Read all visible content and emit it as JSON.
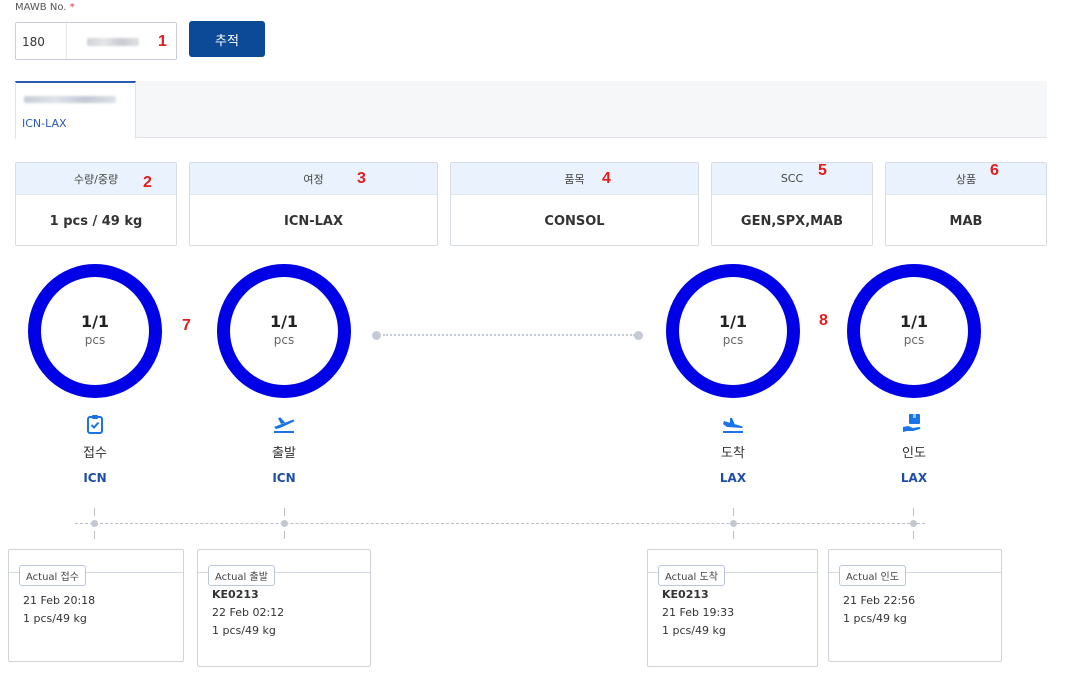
{
  "search": {
    "label": "MAWB No.",
    "required_mark": "*",
    "prefix_value": "180",
    "button_label": "추적"
  },
  "tab": {
    "route": "ICN-LAX"
  },
  "markers": [
    "1",
    "2",
    "3",
    "4",
    "5",
    "6",
    "7",
    "8"
  ],
  "info": [
    {
      "header": "수량/중량",
      "value": "1 pcs / 49 kg"
    },
    {
      "header": "여정",
      "value": "ICN-LAX"
    },
    {
      "header": "품목",
      "value": "CONSOL"
    },
    {
      "header": "SCC",
      "value": "GEN,SPX,MAB"
    },
    {
      "header": "상품",
      "value": "MAB"
    }
  ],
  "stages": [
    {
      "count": "1/1",
      "unit": "pcs",
      "icon": "clipboard-check-icon",
      "label": "접수",
      "port": "ICN"
    },
    {
      "count": "1/1",
      "unit": "pcs",
      "icon": "plane-departure-icon",
      "label": "출발",
      "port": "ICN"
    },
    {
      "count": "1/1",
      "unit": "pcs",
      "icon": "plane-arrival-icon",
      "label": "도착",
      "port": "LAX"
    },
    {
      "count": "1/1",
      "unit": "pcs",
      "icon": "package-hand-icon",
      "label": "인도",
      "port": "LAX"
    }
  ],
  "cards": [
    {
      "badge": "Actual 접수",
      "flight": "",
      "time": "21 Feb 20:18",
      "qty": "1 pcs/49 kg"
    },
    {
      "badge": "Actual 출발",
      "flight": "KE0213",
      "time": "22 Feb 02:12",
      "qty": "1 pcs/49 kg"
    },
    {
      "badge": "Actual 도착",
      "flight": "KE0213",
      "time": "21 Feb 19:33",
      "qty": "1 pcs/49 kg"
    },
    {
      "badge": "Actual 인도",
      "flight": "",
      "time": "21 Feb 22:56",
      "qty": "1 pcs/49 kg"
    }
  ],
  "colors": {
    "primary_button": "#0c4a98",
    "ring": "#0000e6",
    "port_text": "#1f4ea8",
    "info_header_bg": "#eaf3fd",
    "marker_red": "#e31b1b",
    "icon_blue": "#1a73e8"
  }
}
